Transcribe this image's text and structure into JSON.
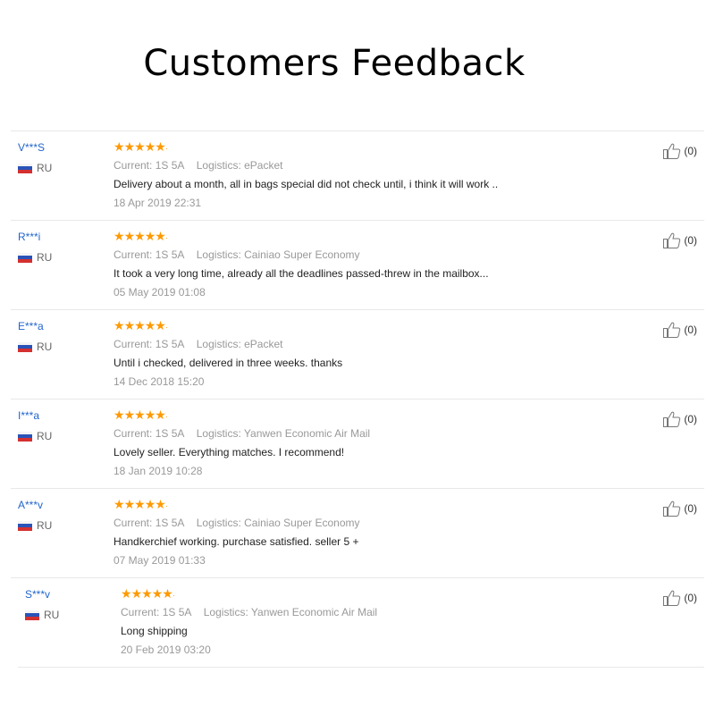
{
  "page": {
    "title": "Customers Feedback"
  },
  "labels": {
    "current": "Current:",
    "logistics": "Logistics:"
  },
  "feedback": [
    {
      "user": "V***S",
      "country": "RU",
      "rating": 5,
      "current": "1S 5A",
      "logistics": "ePacket",
      "comment": "Delivery about a month, all in bags special did not check until, i think it will work ..",
      "date": "18 Apr 2019 22:31",
      "helpful": "(0)"
    },
    {
      "user": "R***i",
      "country": "RU",
      "rating": 5,
      "current": "1S 5A",
      "logistics": "Cainiao Super Economy",
      "comment": "It took a very long time, already all the deadlines passed-threw in the mailbox...",
      "date": "05 May 2019 01:08",
      "helpful": "(0)"
    },
    {
      "user": "E***a",
      "country": "RU",
      "rating": 5,
      "current": "1S 5A",
      "logistics": "ePacket",
      "comment": "Until i checked, delivered in three weeks. thanks",
      "date": "14 Dec 2018 15:20",
      "helpful": "(0)"
    },
    {
      "user": "I***a",
      "country": "RU",
      "rating": 5,
      "current": "1S 5A",
      "logistics": "Yanwen Economic Air Mail",
      "comment": "Lovely seller. Everything matches. I recommend!",
      "date": "18 Jan 2019 10:28",
      "helpful": "(0)"
    },
    {
      "user": "A***v",
      "country": "RU",
      "rating": 5,
      "current": "1S 5A",
      "logistics": "Cainiao Super Economy",
      "comment": "Handkerchief working. purchase satisfied. seller 5 +",
      "date": "07 May 2019 01:33",
      "helpful": "(0)"
    },
    {
      "user": "S***v",
      "country": "RU",
      "rating": 5,
      "current": "1S 5A",
      "logistics": "Yanwen Economic Air Mail",
      "comment": "Long shipping",
      "date": "20 Feb 2019 03:20",
      "helpful": "(0)"
    }
  ],
  "icons": {
    "star": "star-icon",
    "thumbs_up": "thumbs-up-icon",
    "flag": "russia-flag-icon"
  },
  "colors": {
    "star": "#ff9900",
    "username": "#2266cc",
    "muted": "#999999"
  }
}
